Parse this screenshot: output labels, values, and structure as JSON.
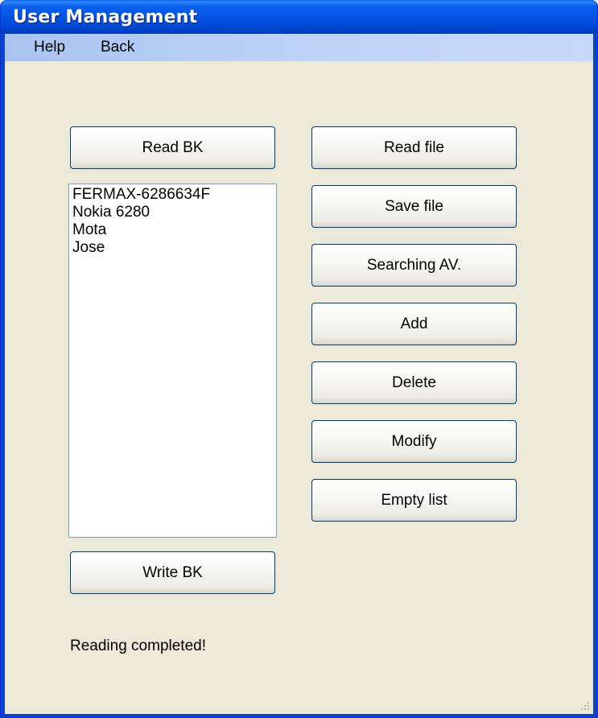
{
  "window": {
    "title": "User Management"
  },
  "menu": [
    "Help",
    "Back"
  ],
  "buttons": {
    "read_bk": "Read BK",
    "write_bk": "Write BK",
    "read_file": "Read file",
    "save_file": "Save file",
    "searching_av": "Searching AV.",
    "add": "Add",
    "delete": "Delete",
    "modify": "Modify",
    "empty_list": "Empty list"
  },
  "device_list": [
    "FERMAX-6286634F",
    "Nokia 6280",
    "Mota",
    "Jose"
  ],
  "status": "Reading completed!",
  "icons": {
    "resize_grip": "resize-grip-icon"
  },
  "colors": {
    "title_bar": "#0054e3",
    "menu_bar": "#bdd2f6",
    "client": "#ece9d8",
    "button_border": "#003c74"
  }
}
